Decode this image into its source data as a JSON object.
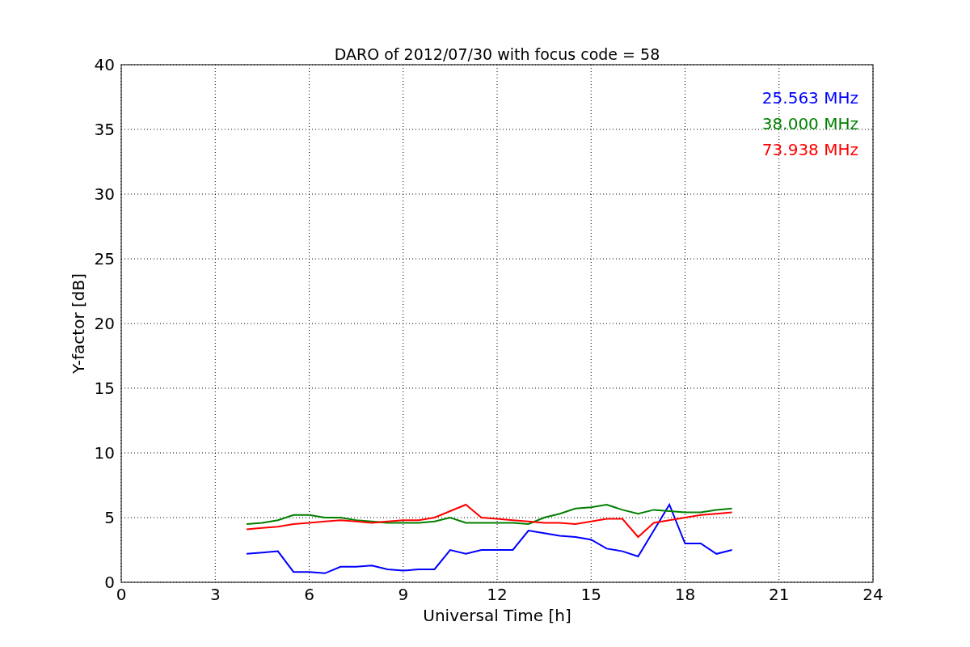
{
  "chart_data": {
    "type": "line",
    "title": "DARO of 2012/07/30 with focus code = 58",
    "xlabel": "Universal Time [h]",
    "ylabel": "Y-factor [dB]",
    "x": [
      4,
      4.5,
      5,
      5.5,
      6,
      6.5,
      7,
      7.5,
      8,
      8.5,
      9,
      9.5,
      10,
      10.5,
      11,
      11.5,
      12,
      12.5,
      13,
      13.5,
      14,
      14.5,
      15,
      15.5,
      16,
      16.5,
      17,
      17.5,
      18,
      18.5,
      19,
      19.5
    ],
    "series": [
      {
        "name": "25.563 MHz",
        "color": "#0000ff",
        "values": [
          2.2,
          2.3,
          2.4,
          0.8,
          0.8,
          0.7,
          1.2,
          1.2,
          1.3,
          1.0,
          0.9,
          1.0,
          1.0,
          2.5,
          2.2,
          2.5,
          2.5,
          2.5,
          4.0,
          3.8,
          3.6,
          3.5,
          3.3,
          2.6,
          2.4,
          2.0,
          4.0,
          6.0,
          3.0,
          3.0,
          2.2,
          2.5
        ]
      },
      {
        "name": "38.000 MHz",
        "color": "#008000",
        "values": [
          4.5,
          4.6,
          4.8,
          5.2,
          5.2,
          5.0,
          5.0,
          4.8,
          4.7,
          4.6,
          4.6,
          4.6,
          4.7,
          5.0,
          4.6,
          4.6,
          4.6,
          4.6,
          4.5,
          5.0,
          5.3,
          5.7,
          5.8,
          6.0,
          5.6,
          5.3,
          5.6,
          5.5,
          5.4,
          5.4,
          5.6,
          5.7
        ]
      },
      {
        "name": "73.938 MHz",
        "color": "#ff0000",
        "values": [
          4.1,
          4.2,
          4.3,
          4.5,
          4.6,
          4.7,
          4.8,
          4.7,
          4.6,
          4.7,
          4.8,
          4.8,
          5.0,
          5.5,
          6.0,
          5.0,
          4.9,
          4.8,
          4.7,
          4.6,
          4.6,
          4.5,
          4.7,
          4.9,
          4.9,
          3.5,
          4.6,
          4.8,
          5.0,
          5.2,
          5.3,
          5.4
        ]
      }
    ],
    "xlim": [
      0,
      24
    ],
    "ylim": [
      0,
      40
    ],
    "xticks": [
      0,
      3,
      6,
      9,
      12,
      15,
      18,
      21,
      24
    ],
    "yticks": [
      0,
      5,
      10,
      15,
      20,
      25,
      30,
      35,
      40
    ],
    "grid": true
  }
}
